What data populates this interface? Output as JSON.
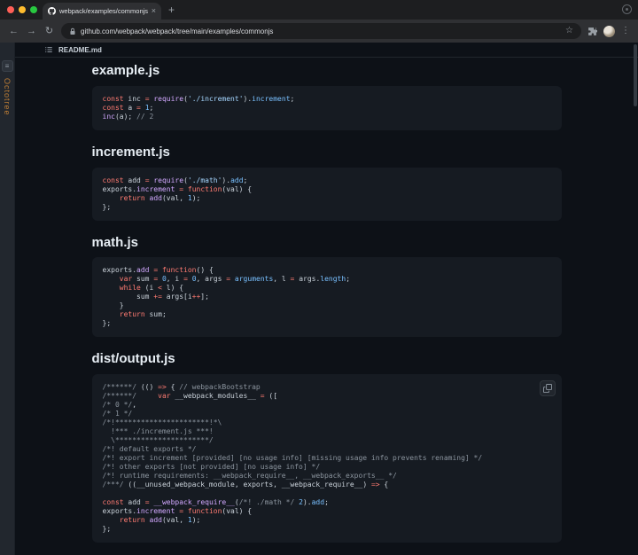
{
  "colors": {
    "traffic_red": "#ff5f57",
    "traffic_yellow": "#febc2e",
    "traffic_green": "#28c840",
    "page_bg": "#0d1117",
    "code_bg": "#161b22",
    "syntax_keyword": "#ff7b72",
    "syntax_function": "#d2a8ff",
    "syntax_string": "#a5d6ff",
    "syntax_constant": "#79c0ff",
    "syntax_comment": "#8b949e",
    "syntax_plain": "#c9d1d9",
    "octotree_accent": "#b97b35"
  },
  "browser": {
    "tab_title": "webpack/examples/commonjs",
    "url": "github.com/webpack/webpack/tree/main/examples/commonjs",
    "icons": {
      "back": "←",
      "forward": "→",
      "reload": "↻",
      "star": "☆",
      "menu": "⋮",
      "new_tab": "+",
      "close_tab": "×"
    }
  },
  "octotree": {
    "label": "Octotree"
  },
  "file_header": {
    "filename": "README.md"
  },
  "readme": {
    "sections": [
      {
        "heading": "example.js",
        "code": [
          [
            [
              "k",
              "const"
            ],
            [
              "p",
              " inc "
            ],
            [
              "k",
              "="
            ],
            [
              "p",
              " "
            ],
            [
              "f",
              "require"
            ],
            [
              "p",
              "("
            ],
            [
              "s",
              "'./increment'"
            ],
            [
              "p",
              ")."
            ],
            [
              "n",
              "increment"
            ],
            [
              "p",
              ";"
            ]
          ],
          [
            [
              "k",
              "const"
            ],
            [
              "p",
              " a "
            ],
            [
              "k",
              "="
            ],
            [
              "p",
              " "
            ],
            [
              "n",
              "1"
            ],
            [
              "p",
              ";"
            ]
          ],
          [
            [
              "f",
              "inc"
            ],
            [
              "p",
              "(a); "
            ],
            [
              "c",
              "// 2"
            ]
          ]
        ]
      },
      {
        "heading": "increment.js",
        "code": [
          [
            [
              "k",
              "const"
            ],
            [
              "p",
              " add "
            ],
            [
              "k",
              "="
            ],
            [
              "p",
              " "
            ],
            [
              "f",
              "require"
            ],
            [
              "p",
              "("
            ],
            [
              "s",
              "'./math'"
            ],
            [
              "p",
              ")."
            ],
            [
              "n",
              "add"
            ],
            [
              "p",
              ";"
            ]
          ],
          [
            [
              "p",
              "exports."
            ],
            [
              "f",
              "increment"
            ],
            [
              "p",
              " "
            ],
            [
              "k",
              "="
            ],
            [
              "p",
              " "
            ],
            [
              "k",
              "function"
            ],
            [
              "p",
              "(val) {"
            ]
          ],
          [
            [
              "p",
              "    "
            ],
            [
              "k",
              "return"
            ],
            [
              "p",
              " "
            ],
            [
              "f",
              "add"
            ],
            [
              "p",
              "(val, "
            ],
            [
              "n",
              "1"
            ],
            [
              "p",
              ");"
            ]
          ],
          [
            [
              "p",
              "};"
            ]
          ]
        ]
      },
      {
        "heading": "math.js",
        "code": [
          [
            [
              "p",
              "exports."
            ],
            [
              "f",
              "add"
            ],
            [
              "p",
              " "
            ],
            [
              "k",
              "="
            ],
            [
              "p",
              " "
            ],
            [
              "k",
              "function"
            ],
            [
              "p",
              "() {"
            ]
          ],
          [
            [
              "p",
              "    "
            ],
            [
              "k",
              "var"
            ],
            [
              "p",
              " sum "
            ],
            [
              "k",
              "="
            ],
            [
              "p",
              " "
            ],
            [
              "n",
              "0"
            ],
            [
              "p",
              ", i "
            ],
            [
              "k",
              "="
            ],
            [
              "p",
              " "
            ],
            [
              "n",
              "0"
            ],
            [
              "p",
              ", args "
            ],
            [
              "k",
              "="
            ],
            [
              "p",
              " "
            ],
            [
              "n",
              "arguments"
            ],
            [
              "p",
              ", l "
            ],
            [
              "k",
              "="
            ],
            [
              "p",
              " args."
            ],
            [
              "n",
              "length"
            ],
            [
              "p",
              ";"
            ]
          ],
          [
            [
              "p",
              "    "
            ],
            [
              "k",
              "while"
            ],
            [
              "p",
              " (i "
            ],
            [
              "k",
              "<"
            ],
            [
              "p",
              " l) {"
            ]
          ],
          [
            [
              "p",
              "        sum "
            ],
            [
              "k",
              "+="
            ],
            [
              "p",
              " args[i"
            ],
            [
              "k",
              "++"
            ],
            [
              "p",
              "];"
            ]
          ],
          [
            [
              "p",
              "    }"
            ]
          ],
          [
            [
              "p",
              "    "
            ],
            [
              "k",
              "return"
            ],
            [
              "p",
              " sum;"
            ]
          ],
          [
            [
              "p",
              "};"
            ]
          ]
        ]
      },
      {
        "heading": "dist/output.js",
        "has_copy_button": true,
        "code": [
          [
            [
              "c",
              "/******/"
            ],
            [
              "p",
              " (() "
            ],
            [
              "k",
              "=>"
            ],
            [
              "p",
              " { "
            ],
            [
              "c",
              "// webpackBootstrap"
            ]
          ],
          [
            [
              "c",
              "/******/"
            ],
            [
              "p",
              "     "
            ],
            [
              "k",
              "var"
            ],
            [
              "p",
              " __webpack_modules__ "
            ],
            [
              "k",
              "="
            ],
            [
              "p",
              " (["
            ]
          ],
          [
            [
              "c",
              "/* 0 */"
            ],
            [
              "p",
              ","
            ]
          ],
          [
            [
              "c",
              "/* 1 */"
            ]
          ],
          [
            [
              "c",
              "/*!**********************!*\\"
            ]
          ],
          [
            [
              "c",
              "  !*** ./increment.js ***!"
            ]
          ],
          [
            [
              "c",
              "  \\**********************/"
            ]
          ],
          [
            [
              "c",
              "/*! default exports */"
            ]
          ],
          [
            [
              "c",
              "/*! export increment [provided] [no usage info] [missing usage info prevents renaming] */"
            ]
          ],
          [
            [
              "c",
              "/*! other exports [not provided] [no usage info] */"
            ]
          ],
          [
            [
              "c",
              "/*! runtime requirements: __webpack_require__, __webpack_exports__ */"
            ]
          ],
          [
            [
              "c",
              "/***/"
            ],
            [
              "p",
              " ((__unused_webpack_module, exports, __webpack_require__) "
            ],
            [
              "k",
              "=>"
            ],
            [
              "p",
              " {"
            ]
          ],
          [],
          [
            [
              "k",
              "const"
            ],
            [
              "p",
              " add "
            ],
            [
              "k",
              "="
            ],
            [
              "p",
              " "
            ],
            [
              "f",
              "__webpack_require__"
            ],
            [
              "p",
              "("
            ],
            [
              "c",
              "/*! ./math */"
            ],
            [
              "p",
              " "
            ],
            [
              "n",
              "2"
            ],
            [
              "p",
              ")."
            ],
            [
              "n",
              "add"
            ],
            [
              "p",
              ";"
            ]
          ],
          [
            [
              "p",
              "exports."
            ],
            [
              "f",
              "increment"
            ],
            [
              "p",
              " "
            ],
            [
              "k",
              "="
            ],
            [
              "p",
              " "
            ],
            [
              "k",
              "function"
            ],
            [
              "p",
              "(val) {"
            ]
          ],
          [
            [
              "p",
              "    "
            ],
            [
              "k",
              "return"
            ],
            [
              "p",
              " "
            ],
            [
              "f",
              "add"
            ],
            [
              "p",
              "(val, "
            ],
            [
              "n",
              "1"
            ],
            [
              "p",
              ");"
            ]
          ],
          [
            [
              "p",
              "};"
            ]
          ]
        ]
      }
    ]
  }
}
